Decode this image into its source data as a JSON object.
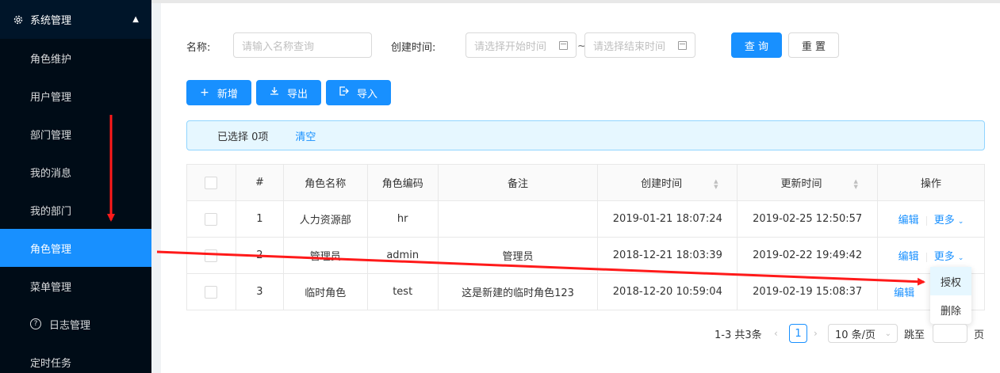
{
  "sidebar": {
    "group_label": "系统管理",
    "group_icon": "gear-icon",
    "items": [
      {
        "label": "角色维护"
      },
      {
        "label": "用户管理"
      },
      {
        "label": "部门管理"
      },
      {
        "label": "我的消息"
      },
      {
        "label": "我的部门"
      },
      {
        "label": "角色管理",
        "active": true
      },
      {
        "label": "菜单管理"
      },
      {
        "label": "日志管理",
        "icon": "question-circle-icon"
      },
      {
        "label": "定时任务"
      }
    ]
  },
  "search": {
    "name_label": "名称:",
    "name_placeholder": "请输入名称查询",
    "time_label": "创建时间:",
    "start_placeholder": "请选择开始时间",
    "range_sep": "~",
    "end_placeholder": "请选择结束时间",
    "query_button": "查 询",
    "reset_button": "重 置"
  },
  "toolbar": {
    "add_label": "新增",
    "export_label": "导出",
    "import_label": "导入"
  },
  "alert": {
    "selected_text": "已选择 0项",
    "clear_label": "清空"
  },
  "table": {
    "columns": [
      "#",
      "角色名称",
      "角色编码",
      "备注",
      "创建时间",
      "更新时间",
      "操作"
    ],
    "rows": [
      {
        "index": "1",
        "name": "人力资源部",
        "code": "hr",
        "remark": "",
        "created": "2019-01-21 18:07:24",
        "updated": "2019-02-25 12:50:57"
      },
      {
        "index": "2",
        "name": "管理员",
        "code": "admin",
        "remark": "管理员",
        "created": "2018-12-21 18:03:39",
        "updated": "2019-02-22 19:49:42"
      },
      {
        "index": "3",
        "name": "临时角色",
        "code": "test",
        "remark": "这是新建的临时角色123",
        "created": "2018-12-20 10:59:04",
        "updated": "2019-02-19 15:08:37"
      }
    ],
    "edit_label": "编辑",
    "more_label": "更多"
  },
  "dropdown": {
    "items": [
      "授权",
      "删除"
    ]
  },
  "pagination": {
    "summary": "1-3 共3条",
    "current_page": "1",
    "page_size": "10 条/页",
    "jump_label": "跳至",
    "page_suffix": "页"
  },
  "colors": {
    "primary": "#1890ff",
    "sidebar_bg": "#001529",
    "annotation_arrow": "#ff1a1a"
  }
}
